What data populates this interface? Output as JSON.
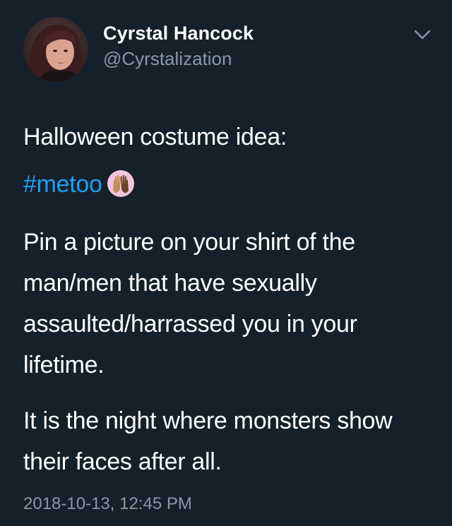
{
  "tweet": {
    "author": {
      "display_name": "Cyrstal Hancock",
      "handle": "@Cyrstalization"
    },
    "menu_icon": "chevron-down-icon",
    "paragraphs": {
      "p1": "Halloween costume idea:",
      "p2_hashtag": "#metoo",
      "p2_emoji": "raised-hands-emoji",
      "p3": "Pin a picture on your shirt of the man/men that have sexually assaulted/harrassed you in your lifetime.",
      "p4": "It is the night where monsters show their faces after all."
    },
    "timestamp": "2018-10-13, 12:45 PM"
  },
  "colors": {
    "background": "#15202b",
    "text": "#ffffff",
    "secondary_text": "#8899a6",
    "link": "#1da1f2"
  }
}
